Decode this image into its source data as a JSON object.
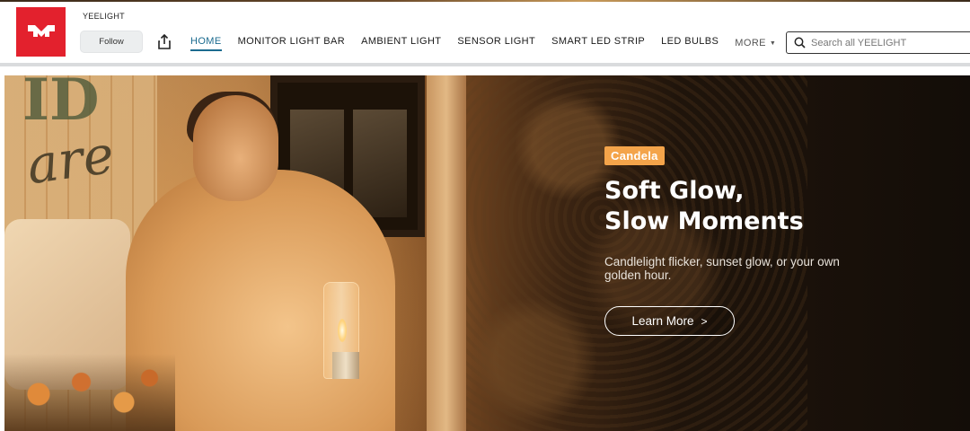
{
  "brand": {
    "name": "YEELIGHT",
    "logo_color": "#e3212d"
  },
  "header": {
    "follow_label": "Follow",
    "share_icon": "share-icon"
  },
  "nav": {
    "items": [
      {
        "label": "HOME",
        "active": true
      },
      {
        "label": "MONITOR LIGHT BAR",
        "active": false
      },
      {
        "label": "AMBIENT LIGHT",
        "active": false
      },
      {
        "label": "SENSOR LIGHT",
        "active": false
      },
      {
        "label": "SMART LED STRIP",
        "active": false
      },
      {
        "label": "LED BULBS",
        "active": false
      }
    ],
    "more_label": "MORE",
    "active_color": "#1b6b8f"
  },
  "search": {
    "placeholder": "Search all YEELIGHT",
    "value": ""
  },
  "hero": {
    "tag": "Candela",
    "headline_line1": "Soft Glow,",
    "headline_line2": "Slow Moments",
    "subcopy": "Candlelight flicker, sunset glow, or your own golden hour.",
    "cta_label": "Learn More",
    "cta_arrow": ">",
    "tag_color": "#f4a44a"
  }
}
